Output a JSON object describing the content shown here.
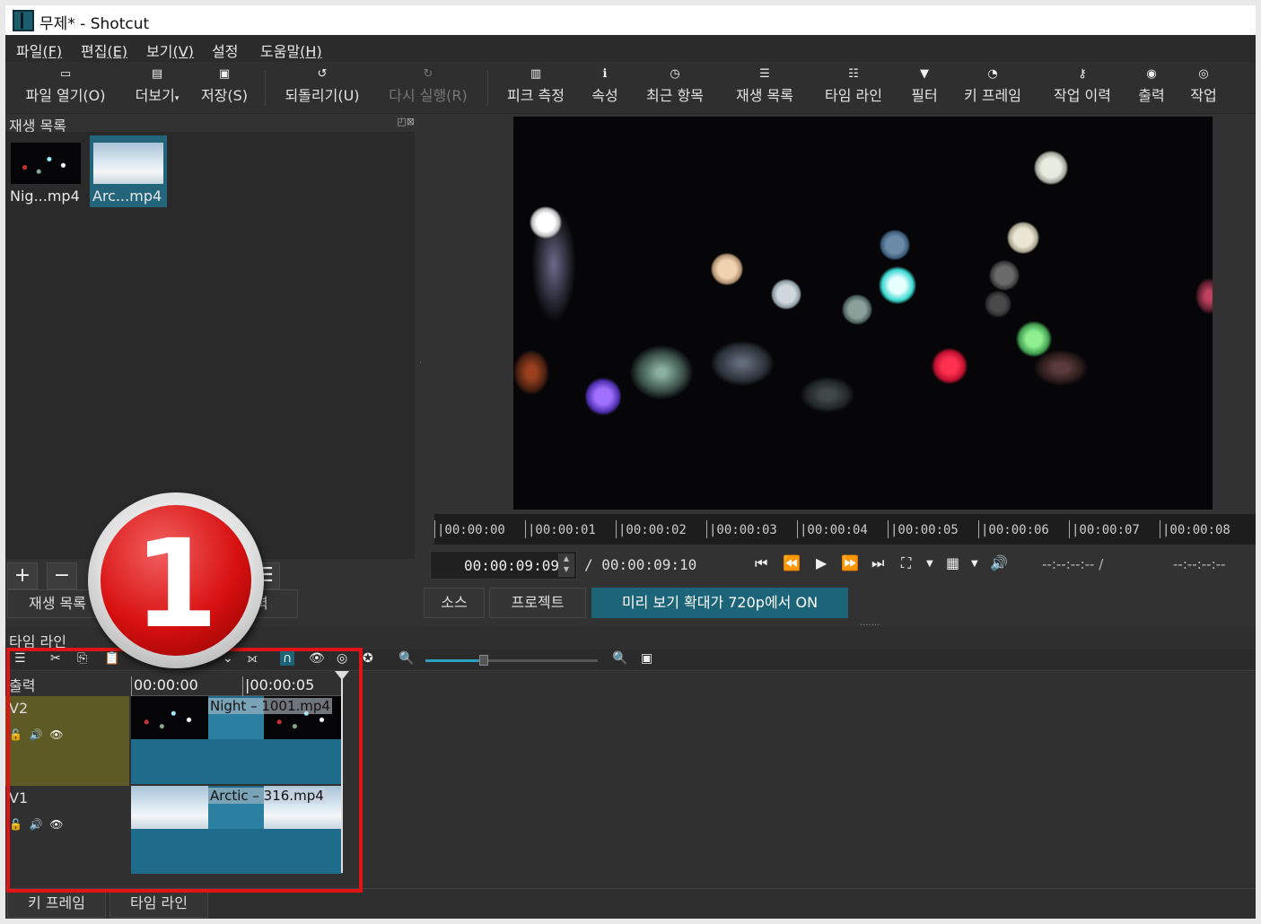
{
  "window": {
    "title": "무제* - Shotcut"
  },
  "menu": [
    {
      "label": "파일",
      "key": "(F)"
    },
    {
      "label": "편집",
      "key": "(E)"
    },
    {
      "label": "보기",
      "key": "(V)"
    },
    {
      "label": "설정",
      "key": ""
    },
    {
      "label": "도움말",
      "key": "(H)"
    }
  ],
  "toolbar": {
    "open": "파일 열기(O)",
    "more": "더보기",
    "save": "저장(S)",
    "undo": "되돌리기(U)",
    "redo": "다시 실행(R)",
    "peak": "피크 측정",
    "properties": "속성",
    "recent": "최근 항목",
    "playlist": "재생 목록",
    "timeline": "타임 라인",
    "filters": "필터",
    "keyframes": "키 프레임",
    "history": "작업 이력",
    "export": "출력",
    "jobs": "작업"
  },
  "playlist": {
    "title": "재생 목록",
    "items": [
      {
        "caption": "Nig...mp4",
        "selected": false
      },
      {
        "caption": "Arc...mp4",
        "selected": true
      }
    ],
    "controls": {
      "add": "+",
      "remove": "−",
      "menu": "☰"
    }
  },
  "dock_tabs": {
    "playlist": "재생 목록",
    "export": "출력"
  },
  "player": {
    "ruler": [
      "|00:00:00",
      "|00:00:01",
      "|00:00:02",
      "|00:00:03",
      "|00:00:04",
      "|00:00:05",
      "|00:00:06",
      "|00:00:07",
      "|00:00:08"
    ],
    "position": "00:00:09:09",
    "duration": "/ 00:00:09:10",
    "in_point": "--:--:--:-- /",
    "out_point": "--:--:--:--",
    "tabs": {
      "source": "소스",
      "project": "프로젝트",
      "preview": "미리 보기 확대가 720p에서 ON"
    }
  },
  "timeline": {
    "title": "타임 라인",
    "output_label": "출력",
    "ruler": [
      "00:00:00",
      "|00:00:05"
    ],
    "zoom_level": 0.34,
    "tracks": [
      {
        "name": "V2",
        "clip": "Night – 1001.mp4",
        "color": "#5e5a25"
      },
      {
        "name": "V1",
        "clip": "Arctic – 316.mp4",
        "color": "#303030"
      }
    ]
  },
  "bottom_tabs": {
    "keyframes": "키 프레임",
    "timeline": "타임 라인"
  },
  "annotation": {
    "badge_number": "1",
    "highlight_color": "#e01414"
  },
  "colors": {
    "accent": "#1c6477",
    "clip": "#1e6b8b"
  }
}
